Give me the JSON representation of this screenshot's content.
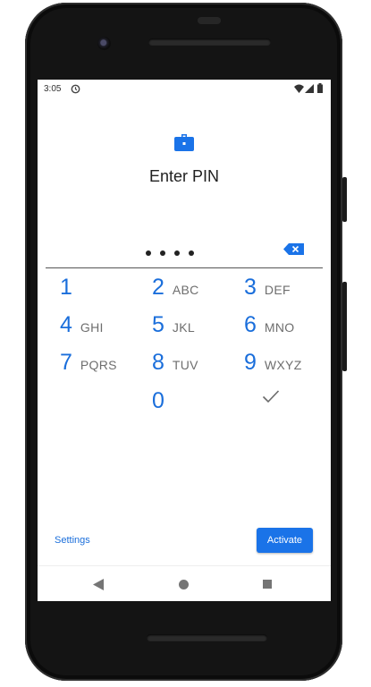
{
  "status_bar": {
    "time": "3:05",
    "icons": [
      "sync-icon",
      "wifi-icon",
      "signal-icon",
      "battery-icon"
    ]
  },
  "lock": {
    "icon": "briefcase-icon",
    "title": "Enter PIN",
    "entered_digits_count": 4
  },
  "keypad": {
    "keys": [
      {
        "digit": "1",
        "letters": ""
      },
      {
        "digit": "2",
        "letters": "ABC"
      },
      {
        "digit": "3",
        "letters": "DEF"
      },
      {
        "digit": "4",
        "letters": "GHI"
      },
      {
        "digit": "5",
        "letters": "JKL"
      },
      {
        "digit": "6",
        "letters": "MNO"
      },
      {
        "digit": "7",
        "letters": "PQRS"
      },
      {
        "digit": "8",
        "letters": "TUV"
      },
      {
        "digit": "9",
        "letters": "WXYZ"
      },
      {
        "digit": "0",
        "letters": ""
      }
    ],
    "enter_icon": "check-icon",
    "delete_icon": "backspace-icon"
  },
  "footer": {
    "settings_label": "Settings",
    "activate_label": "Activate"
  },
  "colors": {
    "accent": "#1a73e8",
    "digit": "#1a6edb",
    "letters": "#6e6e6e",
    "phone_body": "#141414"
  },
  "navbar": {
    "icons": [
      "back-icon",
      "home-icon",
      "recents-icon"
    ]
  }
}
